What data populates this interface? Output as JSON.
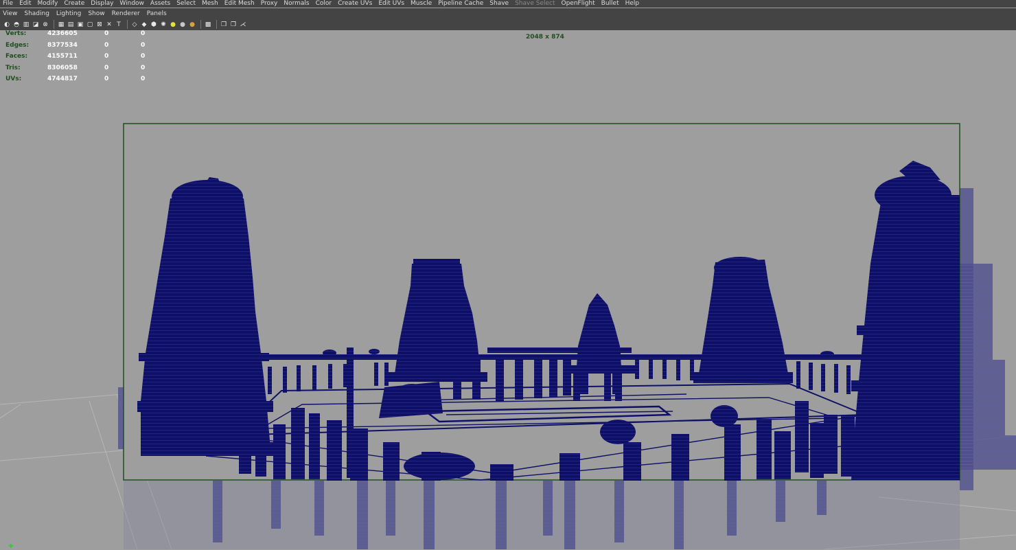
{
  "main_menu": [
    "File",
    "Edit",
    "Modify",
    "Create",
    "Display",
    "Window",
    "Assets",
    "Select",
    "Mesh",
    "Edit Mesh",
    "Proxy",
    "Normals",
    "Color",
    "Create UVs",
    "Edit UVs",
    "Muscle",
    "Pipeline Cache",
    "Shave",
    "Shave Select",
    "OpenFlight",
    "Bullet",
    "Help"
  ],
  "main_menu_disabled": [
    "Shave Select"
  ],
  "panel_menu": [
    "View",
    "Shading",
    "Lighting",
    "Show",
    "Renderer",
    "Panels"
  ],
  "toolbar_icons": [
    {
      "name": "camera-select-icon",
      "glyph": "◐"
    },
    {
      "name": "camera-attributes-icon",
      "glyph": "◓"
    },
    {
      "name": "bookmarks-icon",
      "glyph": "▥"
    },
    {
      "name": "image-plane-icon",
      "glyph": "◪"
    },
    {
      "name": "two-d-pan-zoom-icon",
      "glyph": "⊗"
    },
    {
      "name": "separator",
      "glyph": ""
    },
    {
      "name": "grid-icon",
      "glyph": "▦"
    },
    {
      "name": "film-gate-icon",
      "glyph": "▤"
    },
    {
      "name": "resolution-gate-icon",
      "glyph": "▣"
    },
    {
      "name": "gate-mask-icon",
      "glyph": "▢"
    },
    {
      "name": "field-chart-icon",
      "glyph": "⊠"
    },
    {
      "name": "safe-action-icon",
      "glyph": "✕"
    },
    {
      "name": "safe-title-icon",
      "glyph": "T"
    },
    {
      "name": "separator",
      "glyph": ""
    },
    {
      "name": "wireframe-icon",
      "glyph": "◇"
    },
    {
      "name": "smooth-shade-icon",
      "glyph": "◆"
    },
    {
      "name": "wireframe-on-shaded-icon",
      "glyph": "⬢"
    },
    {
      "name": "xray-icon",
      "glyph": "✺"
    },
    {
      "name": "use-all-lights-icon",
      "glyph": "●"
    },
    {
      "name": "shadows-icon",
      "glyph": "●"
    },
    {
      "name": "high-quality-icon",
      "glyph": "●"
    },
    {
      "name": "separator",
      "glyph": ""
    },
    {
      "name": "isolate-select-icon",
      "glyph": "▩"
    },
    {
      "name": "separator",
      "glyph": ""
    },
    {
      "name": "xray-joints-icon",
      "glyph": "❒"
    },
    {
      "name": "xray-active-components-icon",
      "glyph": "❐"
    },
    {
      "name": "share-icon",
      "glyph": "⋌"
    }
  ],
  "hud": {
    "rows": [
      {
        "label": "Verts:",
        "v1": "4236605",
        "v2": "0",
        "v3": "0"
      },
      {
        "label": "Edges:",
        "v1": "8377534",
        "v2": "0",
        "v3": "0"
      },
      {
        "label": "Faces:",
        "v1": "4155711",
        "v2": "0",
        "v3": "0"
      },
      {
        "label": "Tris:",
        "v1": "8306058",
        "v2": "0",
        "v3": "0"
      },
      {
        "label": "UVs:",
        "v1": "4744817",
        "v2": "0",
        "v3": "0"
      }
    ],
    "resolution": "2048 x 874"
  },
  "colors": {
    "ui_bg": "#444444",
    "viewport_bg": "#9e9e9e",
    "wireframe": "#0e0f66",
    "gate_border": "#1e4d1e",
    "hud_label": "#1f4f1f"
  }
}
